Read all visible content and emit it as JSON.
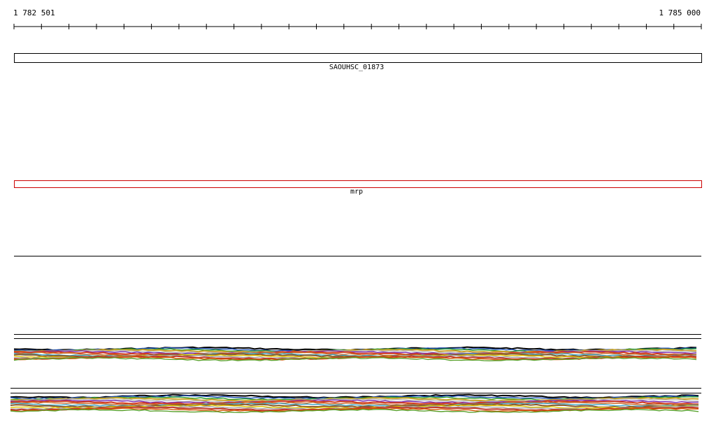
{
  "coordinates": {
    "start": "1 782 501",
    "end": "1 785 000"
  },
  "features": [
    {
      "label": "SAOUHSC_01873",
      "color": "#000000"
    },
    {
      "label": "mrp",
      "color": "#cc0000"
    }
  ],
  "track_palette": [
    "#000000",
    "#1f4fb5",
    "#2a9a2a",
    "#c9a227",
    "#b8b8b8",
    "#7a2ab0",
    "#d23b1f",
    "#c86a2a",
    "#3fa7c7",
    "#8a5a2b",
    "#e0c400",
    "#a3a3a3",
    "#c0392b",
    "#d35400",
    "#5aa02c"
  ]
}
